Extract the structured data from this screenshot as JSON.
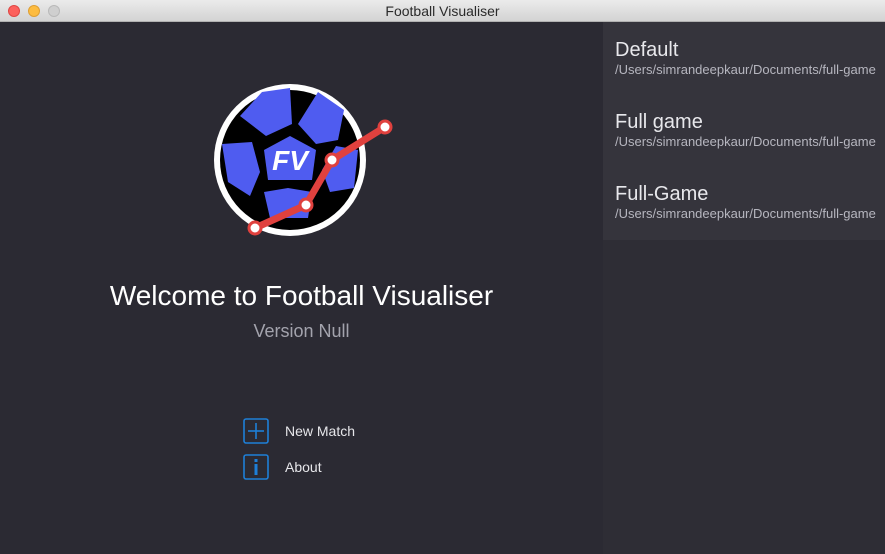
{
  "window": {
    "title": "Football Visualiser"
  },
  "logo": {
    "text": "FV"
  },
  "welcome": {
    "title": "Welcome to Football Visualiser",
    "version": "Version Null"
  },
  "actions": {
    "new_match": {
      "label": "New Match",
      "icon": "plus-square-icon"
    },
    "about": {
      "label": "About",
      "icon": "info-square-icon"
    }
  },
  "recent": [
    {
      "name": "Default",
      "path": "/Users/simrandeepkaur/Documents/full-game"
    },
    {
      "name": "Full game",
      "path": "/Users/simrandeepkaur/Documents/full-game"
    },
    {
      "name": "Full-Game",
      "path": "/Users/simrandeepkaur/Documents/full-game"
    }
  ],
  "colors": {
    "background": "#2b2a33",
    "accent_blue": "#1e7fd8",
    "logo_blue": "#4f5cf0",
    "logo_red": "#e0413e"
  }
}
